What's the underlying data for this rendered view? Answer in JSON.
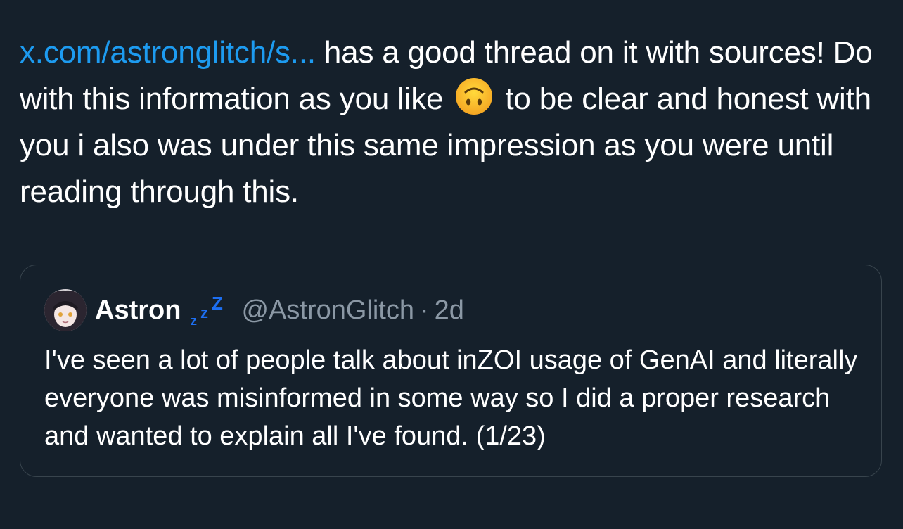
{
  "tweet": {
    "link_text": "x.com/astronglitch/s...",
    "text_part1": " has a good thread on it with sources! Do with this information as you like ",
    "emoji": "upside-down-face-emoji",
    "text_part2": " to be clear and honest with you i also was under this same impression as you were until reading through this."
  },
  "quote": {
    "display_name": "Astron",
    "badge_icon": "zzz-sleep-icon",
    "handle": "@AstronGlitch",
    "separator": "·",
    "time": "2d",
    "text": "I've seen a lot of people talk about inZOI usage of GenAI and literally everyone was misinformed in some way so I did a proper research and wanted to explain all I've found. (1/23)"
  },
  "colors": {
    "background": "#15202b",
    "link": "#1d9bf0",
    "text": "#ffffff",
    "secondary_text": "#8b98a5",
    "border": "#38444d",
    "zzz": "#1d6ff2"
  }
}
